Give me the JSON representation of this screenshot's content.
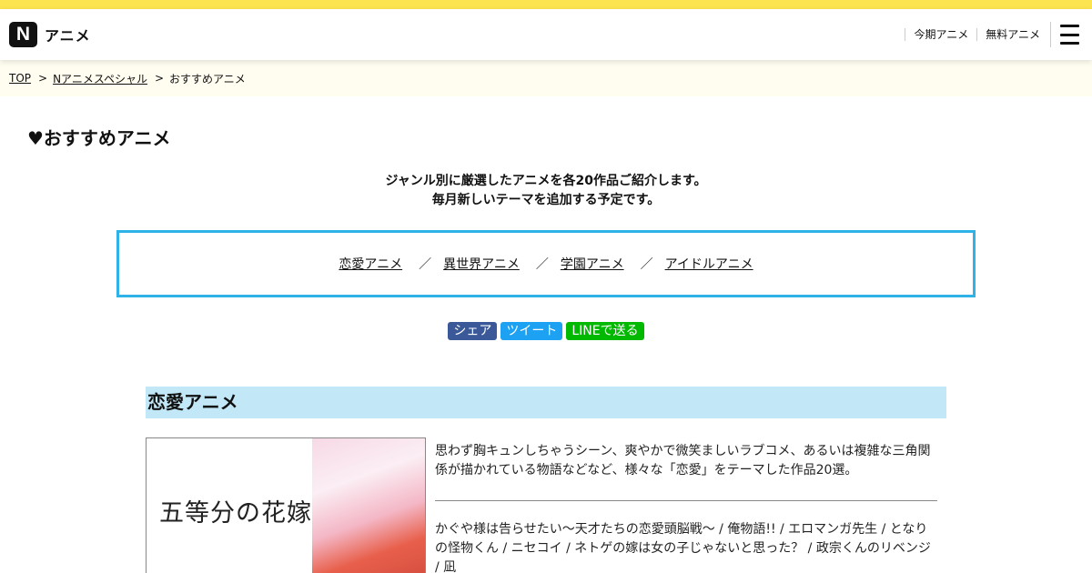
{
  "header": {
    "logo_mark": "N",
    "logo_text": "アニメ",
    "nav": [
      "今期アニメ",
      "無料アニメ"
    ]
  },
  "breadcrumb": {
    "items": [
      "TOP",
      "Nアニメスペシャル",
      "おすすめアニメ"
    ],
    "separator": ">"
  },
  "page": {
    "title": "♥おすすめアニメ",
    "intro_line1": "ジャンル別に厳選したアニメを各20作品ご紹介します。",
    "intro_line2": "毎月新しいテーマを追加する予定です。"
  },
  "genres": {
    "items": [
      "恋愛アニメ",
      "異世界アニメ",
      "学園アニメ",
      "アイドルアニメ"
    ],
    "separator": "／"
  },
  "share": {
    "share_label": "シェア",
    "tweet_label": "ツイート",
    "line_label": "LINEで送る"
  },
  "section": {
    "title": "恋愛アニメ",
    "thumb_title": "五等分の花嫁",
    "description": "思わず胸キュンしちゃうシーン、爽やかで微笑ましいラブコメ、あるいは複雑な三角関係が描かれている物語などなど、様々な「恋愛」をテーマした作品20選。",
    "titles_list": "かぐや様は告らせたい～天才たちの恋愛頭脳戦～ / 俺物語!! / エロマンガ先生 / となりの怪物くん / ニセコイ / ネトゲの嫁は女の子じゃないと思った？ / 政宗くんのリベンジ / 凪"
  },
  "colors": {
    "topbar": "#fbe44f",
    "accent_border": "#2fb2e8",
    "section_bg": "#c2e7f7",
    "facebook": "#3b5998",
    "twitter": "#1da1f2",
    "line": "#00b900"
  }
}
